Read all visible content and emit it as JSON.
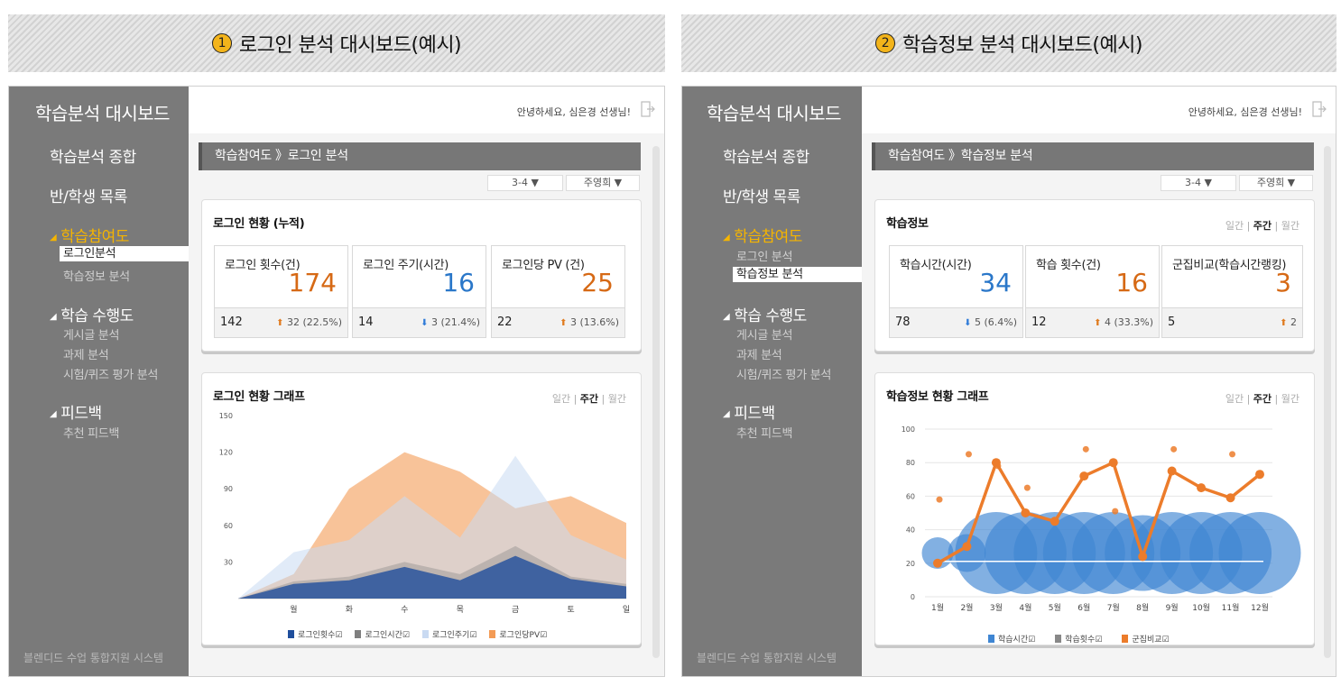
{
  "panels": [
    {
      "header": {
        "number": "1",
        "title": "로그인 분석 대시보드(예시)"
      },
      "brand": "학습분석 대시보드",
      "nav": {
        "summary": "학습분석 종합",
        "students": "반/학생 목록",
        "participation": "학습참여도",
        "participation_items": [
          "로그인분석",
          "학습정보 분석"
        ],
        "performance": "학습 수행도",
        "performance_items": [
          "게시글 분석",
          "과제 분석",
          "시험/퀴즈 평가 분석"
        ],
        "feedback": "피드백",
        "feedback_items": [
          "추천 피드백"
        ]
      },
      "footer": "블렌디드 수업 통합지원 시스템",
      "greeting": "안녕하세요, 심은경 선생님!",
      "breadcrumb": "학습참여도 》로그인 분석",
      "selects": [
        "3-4 ▼",
        "주영희 ▼"
      ],
      "stats_card": {
        "title": "로그인 현황 (누적)",
        "items": [
          {
            "label": "로그인 횟수(건)",
            "value": "174",
            "color": "#d66915",
            "prev": "142",
            "arrow": "up",
            "delta": "32 (22.5%)"
          },
          {
            "label": "로그인 주기(시간)",
            "value": "16",
            "color": "#2a77c9",
            "prev": "14",
            "arrow": "down",
            "delta": "3 (21.4%)"
          },
          {
            "label": "로그인당 PV (건)",
            "value": "25",
            "color": "#d66915",
            "prev": "22",
            "arrow": "up",
            "delta": "3 (13.6%)"
          }
        ]
      },
      "graph_card": {
        "title": "로그인 현황 그래프",
        "period": {
          "daily": "일간",
          "weekly": "주간",
          "monthly": "월간"
        }
      }
    },
    {
      "header": {
        "number": "2",
        "title": "학습정보 분석 대시보드(예시)"
      },
      "brand": "학습분석 대시보드",
      "nav": {
        "summary": "학습분석 종합",
        "students": "반/학생 목록",
        "participation": "학습참여도",
        "participation_items": [
          "로그인 분석",
          "학습정보 분석"
        ],
        "performance": "학습 수행도",
        "performance_items": [
          "게시글 분석",
          "과제 분석",
          "시험/퀴즈 평가 분석"
        ],
        "feedback": "피드백",
        "feedback_items": [
          "추천 피드백"
        ]
      },
      "footer": "블렌디드 수업 통합지원 시스템",
      "greeting": "안녕하세요, 심은경 선생님!",
      "breadcrumb": "학습참여도 》학습정보 분석",
      "selects": [
        "3-4 ▼",
        "주영희 ▼"
      ],
      "stats_card": {
        "title": "학습정보",
        "period": {
          "daily": "일간",
          "weekly": "주간",
          "monthly": "월간"
        },
        "items": [
          {
            "label": "학습시간(시간)",
            "value": "34",
            "color": "#2a77c9",
            "prev": "78",
            "arrow": "down",
            "delta": "5 (6.4%)"
          },
          {
            "label": "학습 횟수(건)",
            "value": "16",
            "color": "#d66915",
            "prev": "12",
            "arrow": "up",
            "delta": "4 (33.3%)"
          },
          {
            "label": "군집비교(학습시간랭킹)",
            "value": "3",
            "color": "#d66915",
            "prev": "5",
            "arrow": "up",
            "delta": "2"
          }
        ]
      },
      "graph_card": {
        "title": "학습정보 현황 그래프",
        "period": {
          "daily": "일간",
          "weekly": "주간",
          "monthly": "월간"
        }
      }
    }
  ],
  "chart_data": [
    {
      "type": "area",
      "title": "로그인 현황 그래프",
      "categories": [
        "",
        "월",
        "화",
        "수",
        "목",
        "금",
        "토",
        "일"
      ],
      "ylim": [
        0,
        150
      ],
      "yticks": [
        30,
        60,
        90,
        120,
        150
      ],
      "series": [
        {
          "name": "로그인횟수☑",
          "color": "#1f4e9c",
          "values": [
            0,
            12,
            15,
            26,
            15,
            35,
            16,
            10
          ]
        },
        {
          "name": "로그인시간☑",
          "color": "#7f7f7f",
          "values": [
            0,
            14,
            18,
            30,
            20,
            43,
            18,
            12
          ]
        },
        {
          "name": "로그인주기☑",
          "color": "#c9daf2",
          "values": [
            0,
            38,
            48,
            84,
            50,
            117,
            52,
            32
          ]
        },
        {
          "name": "로그인당PV☑",
          "color": "#f39b55",
          "values": [
            0,
            20,
            90,
            120,
            104,
            74,
            84,
            62
          ]
        }
      ]
    },
    {
      "type": "scatter",
      "title": "학습정보 현황 그래프",
      "categories": [
        "1월",
        "2월",
        "3월",
        "4월",
        "5월",
        "6월",
        "7월",
        "8월",
        "9월",
        "10월",
        "11월",
        "12월"
      ],
      "ylim": [
        0,
        100
      ],
      "yticks": [
        0,
        20,
        40,
        60,
        80,
        100
      ],
      "series": [
        {
          "name": "학습시간☑",
          "color": "#3f86d3",
          "type": "bubble",
          "x": [
            1,
            2,
            3,
            4,
            5,
            6,
            7,
            8,
            9,
            10,
            11,
            12
          ],
          "y": [
            25,
            25,
            25,
            25,
            25,
            25,
            25,
            25,
            25,
            25,
            25,
            25
          ],
          "size": [
            10,
            12,
            26,
            26,
            26,
            26,
            26,
            24,
            26,
            26,
            26,
            26
          ]
        },
        {
          "name": "학습횟수☑",
          "color": "#888888",
          "type": "line",
          "x": [],
          "y": []
        },
        {
          "name": "군집비교☑",
          "color": "#ec7c2b",
          "type": "line",
          "x": [
            1,
            2,
            3,
            4,
            5,
            6,
            7,
            8,
            9,
            10,
            11,
            12
          ],
          "y": [
            20,
            30,
            80,
            50,
            45,
            72,
            80,
            24,
            75,
            65,
            59,
            73
          ]
        },
        {
          "name": "",
          "color": "#ec7c2b",
          "type": "dots",
          "x": [
            1,
            2,
            3,
            4,
            6,
            7,
            9,
            11
          ],
          "y": [
            58,
            85,
            78,
            65,
            88,
            51,
            88,
            85
          ]
        }
      ]
    }
  ]
}
